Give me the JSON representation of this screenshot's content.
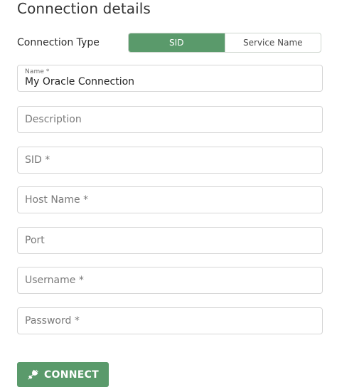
{
  "header": {
    "title": "Connection details"
  },
  "connection_type": {
    "label": "Connection Type",
    "options": [
      "SID",
      "Service Name"
    ],
    "selected": "SID"
  },
  "fields": {
    "name": {
      "label": "Name *",
      "value": "My Oracle Connection"
    },
    "description": {
      "placeholder": "Description",
      "value": ""
    },
    "sid": {
      "placeholder": "SID *",
      "value": ""
    },
    "host_name": {
      "placeholder": "Host Name *",
      "value": ""
    },
    "port": {
      "placeholder": "Port",
      "value": ""
    },
    "username": {
      "placeholder": "Username *",
      "value": ""
    },
    "password": {
      "placeholder": "Password *",
      "value": ""
    }
  },
  "actions": {
    "connect_label": "CONNECT",
    "connect_icon": "plug-icon"
  },
  "colors": {
    "accent": "#5a9a6b",
    "border": "#d6d6d6",
    "text": "#2b2b2b",
    "placeholder": "#7a7a7a",
    "background": "#ffffff"
  }
}
